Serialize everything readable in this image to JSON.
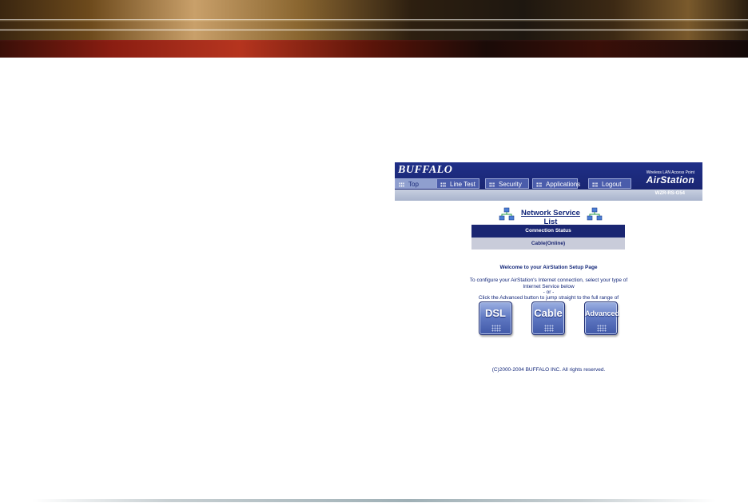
{
  "router_page": {
    "brand": "BUFFALO",
    "product_tagline": "Wireless LAN Access Point",
    "product_name": "AirStation",
    "tabs": [
      {
        "label": "Top",
        "active": true
      },
      {
        "label": "Line Test",
        "active": false
      },
      {
        "label": "Security",
        "active": false
      },
      {
        "label": "Applications",
        "active": false
      },
      {
        "label": "Logout",
        "active": false
      }
    ],
    "model": "WZR-RS-G54",
    "service_list_title": "Network Service List",
    "connection_status_header": "Connection Status",
    "connection_status_value": "Cable(Online)",
    "welcome": "Welcome to your AirStation Setup Page",
    "instructions": [
      "To configure your AirStation's Internet connection, select your type of",
      "Internet Service below",
      "- or -",
      "Click the Advanced button to jump straight to the full range of"
    ],
    "buttons": [
      {
        "label": "DSL"
      },
      {
        "label": "Cable"
      },
      {
        "label": "Advanced"
      }
    ],
    "copyright": "(C)2000-2004 BUFFALO INC. All rights reserved.",
    "colors": {
      "header_blue": "#1f2f88",
      "tab_blue": "#4a5cab",
      "text_blue": "#14287a",
      "status_bg": "#c9ccda"
    },
    "icons": {
      "service_list": "network-nodes-icon",
      "tab_marker": "dot-grid-icon"
    }
  }
}
